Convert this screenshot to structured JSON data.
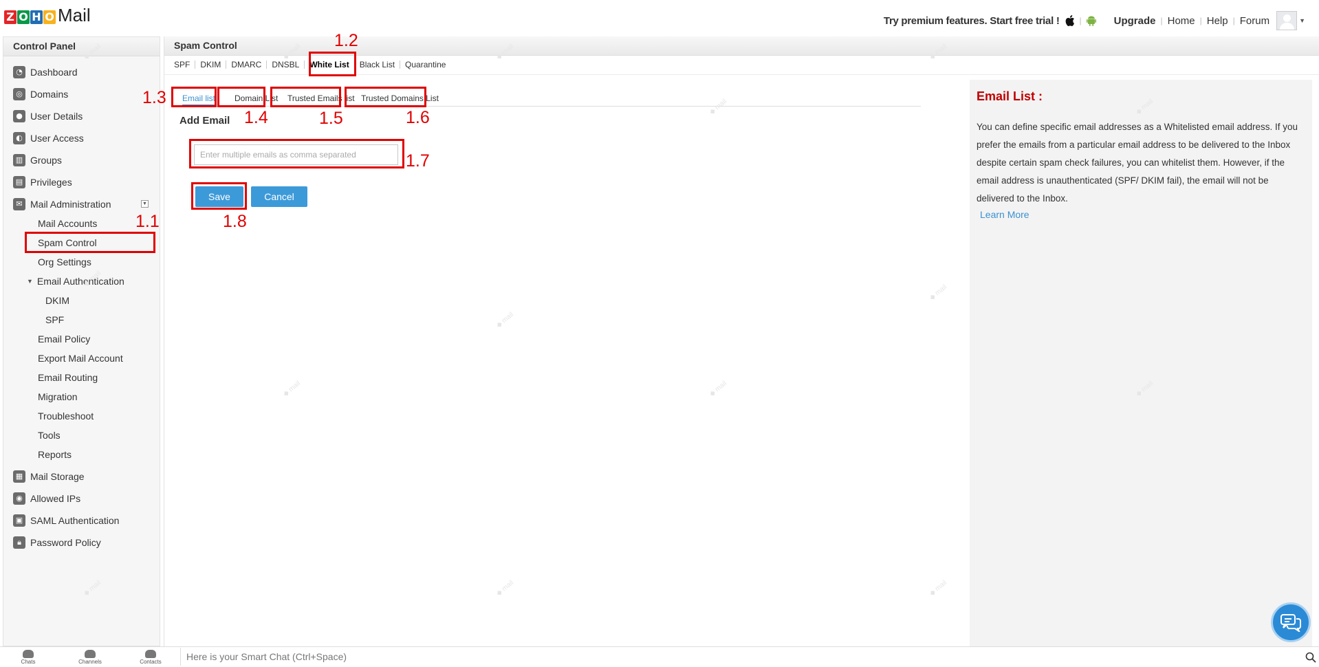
{
  "header": {
    "logo_letters": [
      "Z",
      "O",
      "H",
      "O"
    ],
    "logo_colors": [
      "#e42527",
      "#089949",
      "#226db4",
      "#f9b21d"
    ],
    "logo_text": "Mail",
    "premium_text": "Try premium features. Start free trial !",
    "links": [
      "Upgrade",
      "Home",
      "Help",
      "Forum"
    ],
    "icons": [
      "apple-icon",
      "android-icon"
    ]
  },
  "sidebar": {
    "title": "Control Panel",
    "items": [
      {
        "label": "Dashboard",
        "icon": "dashboard-icon"
      },
      {
        "label": "Domains",
        "icon": "domains-icon"
      },
      {
        "label": "User Details",
        "icon": "user-details-icon"
      },
      {
        "label": "User Access",
        "icon": "user-access-icon"
      },
      {
        "label": "Groups",
        "icon": "groups-icon"
      },
      {
        "label": "Privileges",
        "icon": "privileges-icon"
      },
      {
        "label": "Mail Administration",
        "icon": "mail-icon"
      }
    ],
    "mail_admin_sub": [
      "Mail Accounts",
      "Spam Control",
      "Org Settings",
      "Email Authentication",
      "DKIM",
      "SPF",
      "Email Policy",
      "Export Mail Account",
      "Email Routing",
      "Migration",
      "Troubleshoot",
      "Tools",
      "Reports"
    ],
    "bottom_items": [
      {
        "label": "Mail Storage",
        "icon": "storage-icon"
      },
      {
        "label": "Allowed IPs",
        "icon": "allowed-ips-icon"
      },
      {
        "label": "SAML Authentication",
        "icon": "saml-icon"
      },
      {
        "label": "Password Policy",
        "icon": "lock-icon"
      }
    ]
  },
  "main": {
    "title": "Spam Control",
    "tabs": [
      "SPF",
      "DKIM",
      "DMARC",
      "DNSBL",
      "White List",
      "Black List",
      "Quarantine"
    ],
    "active_tab": "White List",
    "sub_tabs": [
      "Email list",
      "Domain List",
      "Trusted Emails list",
      "Trusted Domains List"
    ],
    "active_sub_tab": "Email list",
    "add_email_title": "Add Email",
    "email_placeholder": "Enter multiple emails as comma separated",
    "save_label": "Save",
    "cancel_label": "Cancel"
  },
  "info": {
    "title": "Email List :",
    "text": "You can define specific email addresses as a Whitelisted email address. If you prefer the emails from a particular email address to be delivered to the Inbox despite certain spam check failures, you can whitelist them. However, if the email address is unauthenticated (SPF/ DKIM fail), the email will not be delivered to the Inbox.",
    "learn_more": "Learn More"
  },
  "annotations": [
    "1.1",
    "1.2",
    "1.3",
    "1.4",
    "1.5",
    "1.6",
    "1.7",
    "1.8"
  ],
  "bottom_bar": {
    "items": [
      "Chats",
      "Channels",
      "Contacts"
    ],
    "smart_chat_placeholder": "Here is your Smart Chat (Ctrl+Space)"
  },
  "colors": {
    "annotation": "#e00000",
    "accent": "#3d9ad9",
    "info_title": "#c00000"
  }
}
